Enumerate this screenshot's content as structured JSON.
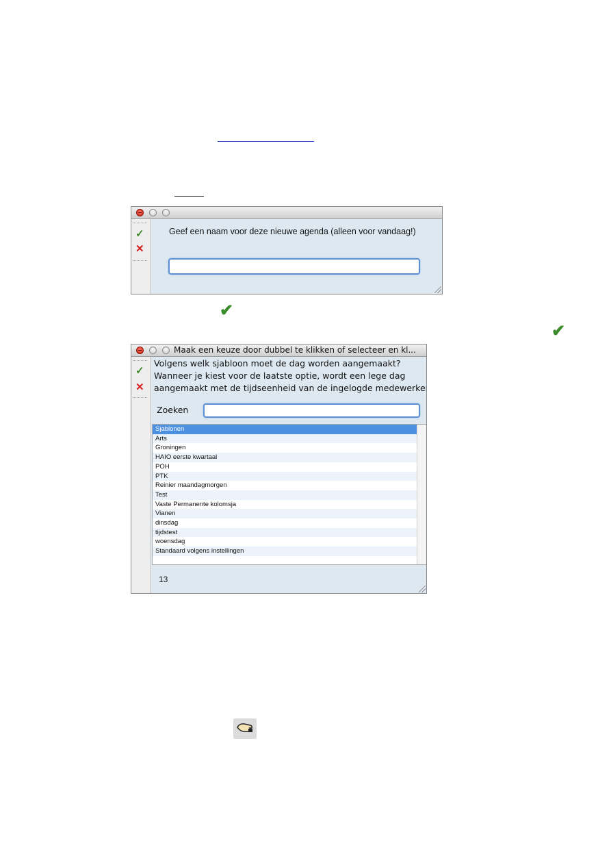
{
  "dialog1": {
    "prompt": "Geef een naam voor deze nieuwe agenda (alleen voor vandaag!)",
    "input_value": "",
    "ok_icon": "checkmark-icon",
    "cancel_icon": "x-icon"
  },
  "dialog2": {
    "title": "Maak een keuze door dubbel te klikken of selecteer en kl...",
    "description_lines": [
      "Volgens welk sjabloon moet de dag worden aangemaakt?",
      "Wanneer je kiest voor de laatste optie, wordt een lege dag",
      "aangemaakt met de tijdseenheid van de ingelogde medewerker"
    ],
    "search_label": "Zoeken",
    "search_value": "",
    "list_items": [
      "Sjablonen",
      "Arts",
      "Groningen",
      "HAIO eerste kwartaal",
      "POH",
      "PTK",
      "Reinier maandagmorgen",
      "Test",
      "Vaste Permanente kolomsja",
      "Vianen",
      "dinsdag",
      "tijdstest",
      "woensdag",
      "Standaard volgens instellingen"
    ],
    "selected_index": 0,
    "count": "13"
  },
  "colors": {
    "ok_green": "#3f8a2a",
    "cancel_red": "#d81e1e",
    "link_blue": "#2b3fd6",
    "selection_blue": "#4d8fe0"
  }
}
